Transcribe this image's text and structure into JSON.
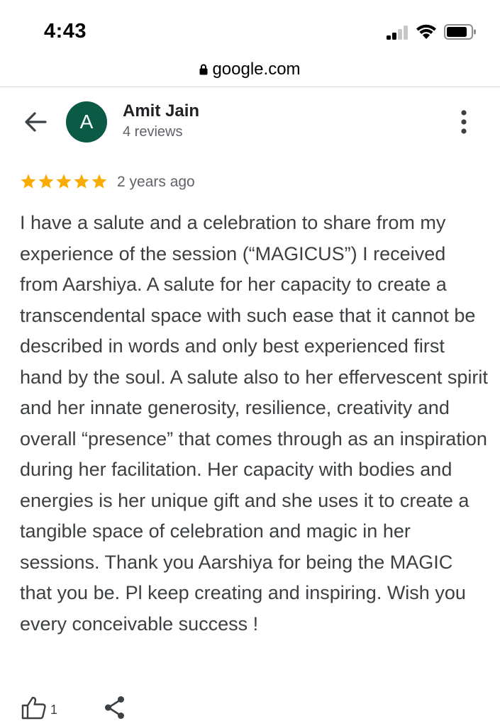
{
  "status_bar": {
    "time": "4:43"
  },
  "browser": {
    "url": "google.com"
  },
  "review": {
    "avatar_letter": "A",
    "reviewer_name": "Amit Jain",
    "reviewer_review_count": "4 reviews",
    "rating": 5,
    "rating_max": 5,
    "date": "2 years ago",
    "text": "I have a salute and a celebration to share from my experience of the session (“MAGICUS”) I received from Aarshiya. A salute for her capacity to create a transcendental space with such ease that it cannot be described in words and only best experienced first hand by the soul. A salute also to her effervescent spirit and her innate generosity, resilience, creativity and overall “presence” that comes through as an inspiration during her facilitation. Her capacity with bodies and energies is her unique gift and she uses it to create a tangible space of celebration and magic in her sessions. Thank you Aarshiya for being the MAGIC that you be. Pl keep creating and inspiring. Wish you every conceivable success !",
    "like_count": "1"
  },
  "colors": {
    "avatar_bg": "#0b5a45",
    "star": "#f9ab00",
    "text": "#3c4043",
    "secondary": "#5f6368"
  },
  "icons": [
    "signal-icon",
    "wifi-icon",
    "battery-icon",
    "lock-icon",
    "back-arrow-icon",
    "more-vert-icon",
    "star-icon",
    "thumb-up-icon",
    "share-icon"
  ]
}
